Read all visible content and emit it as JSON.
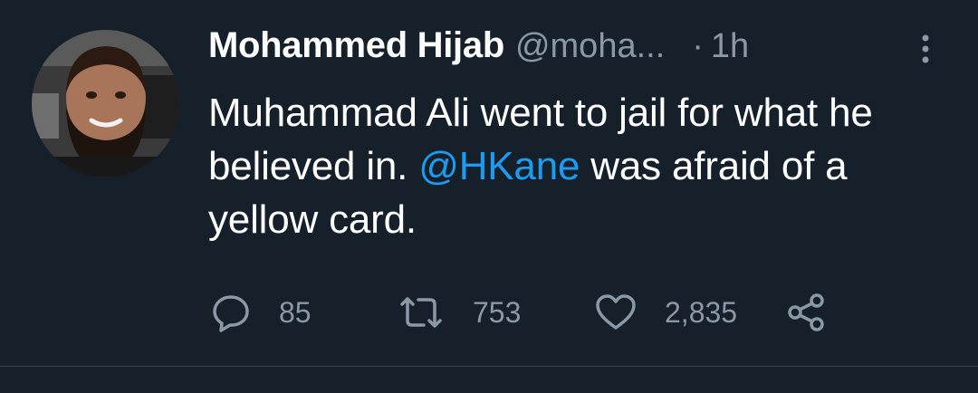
{
  "tweet": {
    "author_name": "Mohammed Hijab",
    "handle": "@moha...",
    "separator": "·",
    "time": "1h",
    "text_before": "Muhammad Ali went to jail for what he believed in. ",
    "mention": "@HKane",
    "text_after": " was afraid of a yellow card.",
    "replies": "85",
    "retweets": "753",
    "likes": "2,835"
  },
  "icons": {
    "more": "more-vertical-icon",
    "reply": "reply-bubble-icon",
    "retweet": "retweet-icon",
    "like": "heart-icon",
    "share": "share-icon"
  },
  "colors": {
    "background": "#15202b",
    "text": "#ffffff",
    "secondary": "#8b98a5",
    "link": "#1d9bf0"
  }
}
